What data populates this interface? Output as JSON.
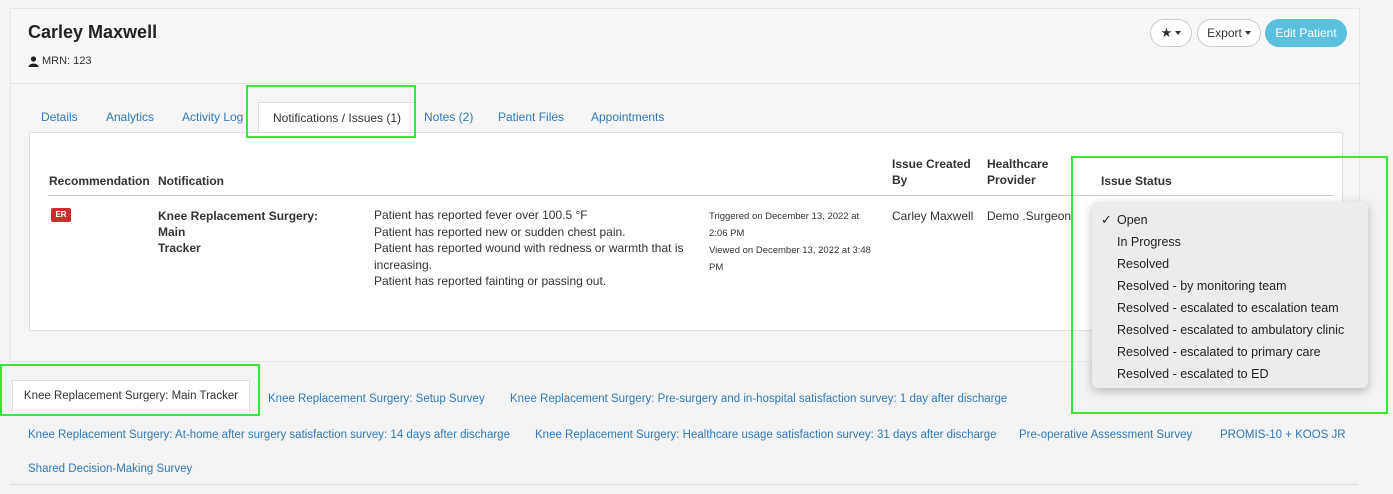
{
  "patient": {
    "name": "Carley Maxwell",
    "mrn": "MRN: 123"
  },
  "toolbar": {
    "star_label": "★",
    "export_label": "Export",
    "edit_label": "Edit Patient"
  },
  "tabs": [
    {
      "label": "Details"
    },
    {
      "label": "Analytics"
    },
    {
      "label": "Activity Log"
    },
    {
      "label": "Notifications / Issues (1)"
    },
    {
      "label": "Notes (2)"
    },
    {
      "label": "Patient Files"
    },
    {
      "label": "Appointments"
    }
  ],
  "table": {
    "headers": {
      "recommendation": "Recommendation",
      "notification": "Notification",
      "created_by_1": "Issue Created",
      "created_by_2": "By",
      "provider_1": "Healthcare",
      "provider_2": "Provider",
      "status": "Issue Status"
    },
    "row": {
      "badge": "ER",
      "notification_title_1": "Knee Replacement Surgery: Main",
      "notification_title_2": "Tracker",
      "details": [
        "Patient has reported fever over 100.5 °F",
        "Patient has reported new or sudden chest pain.",
        "Patient has reported wound with redness or warmth that is",
        "increasing.",
        "Patient has reported fainting or passing out."
      ],
      "timestamps": [
        "Triggered on December 13, 2022 at",
        "2:06 PM",
        "Viewed on December 13, 2022 at 3:48",
        "PM"
      ],
      "created_by": "Carley Maxwell",
      "provider": "Demo .Surgeon"
    }
  },
  "status_dropdown": {
    "selected": "Open",
    "options": [
      "Open",
      "In Progress",
      "Resolved",
      "Resolved - by monitoring team",
      "Resolved - escalated to escalation team",
      "Resolved - escalated to ambulatory clinic",
      "Resolved - escalated to primary care",
      "Resolved - escalated to ED"
    ]
  },
  "surveys": [
    "Knee Replacement Surgery: Main Tracker",
    "Knee Replacement Surgery: Setup Survey",
    "Knee Replacement Surgery: Pre-surgery and in-hospital satisfaction survey: 1 day after discharge",
    "Knee Replacement Surgery: At-home after surgery satisfaction survey: 14 days after discharge",
    "Knee Replacement Surgery: Healthcare usage satisfaction survey: 31 days after discharge",
    "Pre-operative Assessment Survey",
    "PROMIS-10 + KOOS JR",
    "Shared Decision-Making Survey"
  ],
  "colors": {
    "link": "#337ab7",
    "edit_button": "#5bc0de",
    "er_badge": "#c9302c",
    "highlight": "#39e639"
  }
}
